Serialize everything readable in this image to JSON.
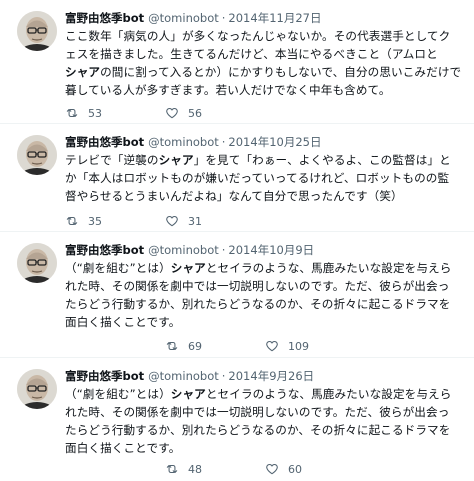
{
  "tweets": [
    {
      "name": "富野由悠季bot",
      "handle": "@tominobot",
      "separator": "·",
      "date": "2014年11月27日",
      "lines": [
        [
          {
            "t": "ここ数年「病気の人」が多くなったんじゃないか。その代表選手としてク"
          }
        ],
        [
          {
            "t": "ェスを描きました。生きてるんだけど、本当にやるべきこと（アムロと"
          }
        ],
        [
          {
            "t": "シャア",
            "b": true
          },
          {
            "t": "の間に割って入るとか）にかすりもしないで、自分の思いこみだけで"
          }
        ],
        [
          {
            "t": "暮している人が多すぎます。若い人だけでなく中年も含めて。"
          }
        ]
      ],
      "retweets": "53",
      "likes": "56"
    },
    {
      "name": "富野由悠季bot",
      "handle": "@tominobot",
      "separator": "·",
      "date": "2014年10月25日",
      "lines": [
        [
          {
            "t": "テレビで「逆襲の"
          },
          {
            "t": "シャア",
            "b": true
          },
          {
            "t": "」を見て「わぁー、よくやるよ、この監督は」と"
          }
        ],
        [
          {
            "t": "か「本人はロボットものが嫌いだっていってるけれど、ロボットものの監"
          }
        ],
        [
          {
            "t": "督やらせるとうまいんだよね」なんて自分で思ったんです（笑）"
          }
        ]
      ],
      "retweets": "35",
      "likes": "31"
    },
    {
      "name": "富野由悠季bot",
      "handle": "@tominobot",
      "separator": "·",
      "date": "2014年10月9日",
      "lines": [
        [
          {
            "t": "（“劇を組む”とは）"
          },
          {
            "t": "シャア",
            "b": true
          },
          {
            "t": "とセイラのような、馬鹿みたいな設定を与えら"
          }
        ],
        [
          {
            "t": "れた時、その関係を劇中では一切説明しないのです。ただ、彼らが出会っ"
          }
        ],
        [
          {
            "t": "たらどう行動するか、別れたらどうなるのか、その折々に起こるドラマを"
          }
        ],
        [
          {
            "t": "面白く描くことです。"
          }
        ]
      ],
      "retweets": "69",
      "likes": "109"
    },
    {
      "name": "富野由悠季bot",
      "handle": "@tominobot",
      "separator": "·",
      "date": "2014年9月26日",
      "lines": [
        [
          {
            "t": "（“劇を組む”とは）"
          },
          {
            "t": "シャア",
            "b": true
          },
          {
            "t": "とセイラのような、馬鹿みたいな設定を与えら"
          }
        ],
        [
          {
            "t": "れた時、その関係を劇中では一切説明しないのです。ただ、彼らが出会っ"
          }
        ],
        [
          {
            "t": "たらどう行動するか、別れたらどうなるのか、その折々に起こるドラマを"
          }
        ],
        [
          {
            "t": "面白く描くことです。"
          }
        ]
      ],
      "retweets": "48",
      "likes": "60"
    }
  ],
  "icons": {
    "retweet": "retweet-icon",
    "like": "heart-icon"
  },
  "colors": {
    "text": "#0f1419",
    "muted": "#536471",
    "divider": "#eff3f4"
  }
}
